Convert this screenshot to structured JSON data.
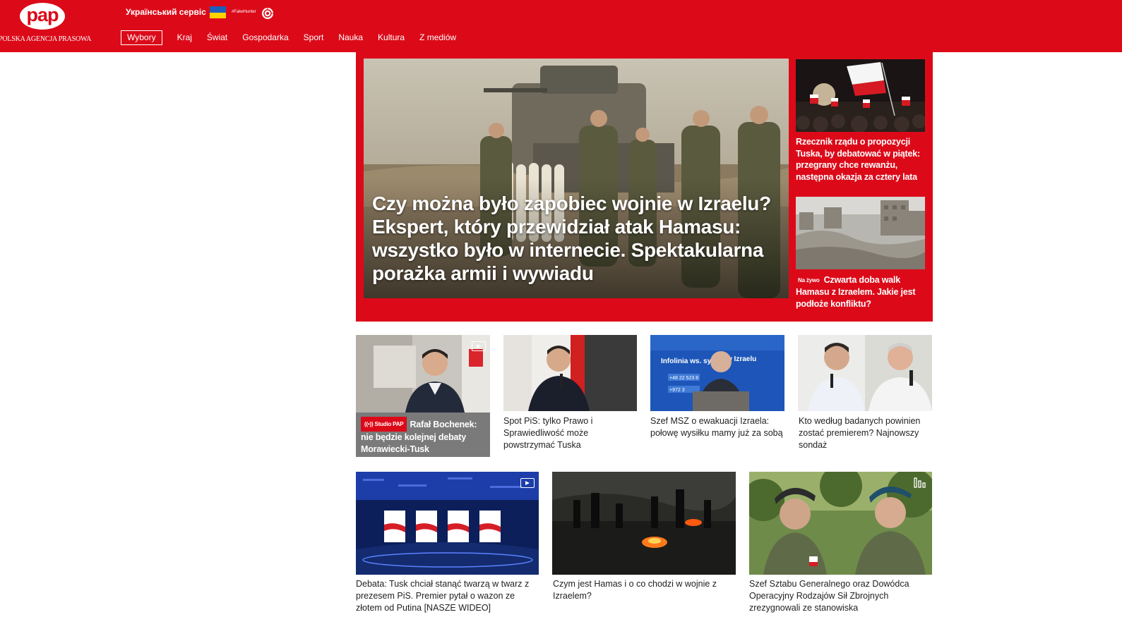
{
  "header": {
    "logo_text": "pap",
    "logo_subtitle": "POLSKA AGENCJA PRASOWA",
    "ua_service": "Український сервіс",
    "fakehunter": "#FakeHunter",
    "brand_color": "#dc0a19"
  },
  "nav": {
    "items": [
      "Wybory",
      "Kraj",
      "Świat",
      "Gospodarka",
      "Sport",
      "Nauka",
      "Kultura",
      "Z mediów"
    ],
    "active": "Wybory"
  },
  "hero": {
    "title": "Czy można było zapobiec wojnie w Izraelu? Ekspert, który przewidział atak Hamasu: wszystko było w internecie. Spektakularna porażka armii i wywiadu"
  },
  "side": {
    "items": [
      {
        "title": "Rzecznik rządu o propozycji Tuska, by debatować w piątek: przegrany chce rewanżu, następna okazja za cztery lata"
      },
      {
        "badge": "Na żywo",
        "title": "Czwarta doba walk Hamasu z Izraelem. Jakie jest podłoże konfliktu?"
      }
    ]
  },
  "row1": {
    "studio": {
      "badge": "((•)) Studio PAP",
      "title": "Rafał Bochenek: nie będzie kolejnej debaty Morawiecki-Tusk",
      "icon": "video-icon"
    },
    "items": [
      {
        "title": "Spot PiS: tylko Prawo i Sprawiedliwość może powstrzymać Tuska"
      },
      {
        "title": "Szef MSZ o ewakuacji Izraela: połowę wysiłku mamy już za sobą",
        "image_text_1": "Infolinia ws. sytu",
        "image_text_2": "w Izraelu",
        "image_text_3": "+48 22 523 8",
        "image_text_4": "+972 3"
      },
      {
        "title": "Kto według badanych powinien zostać premierem? Najnowszy sondaż"
      }
    ]
  },
  "row2": {
    "items": [
      {
        "title": "Debata: Tusk chciał stanąć twarzą w twarz z prezesem PiS. Premier pytał o wazon ze złotem od Putina [NASZE WIDEO]",
        "icon": "video-icon"
      },
      {
        "title": "Czym jest Hamas i o co chodzi w wojnie z Izraelem?"
      },
      {
        "title": "Szef Sztabu Generalnego oraz Dowódca Operacyjny Rodzajów Sił Zbrojnych zrezygnowali ze stanowiska",
        "icon": "gallery-icon"
      }
    ]
  }
}
